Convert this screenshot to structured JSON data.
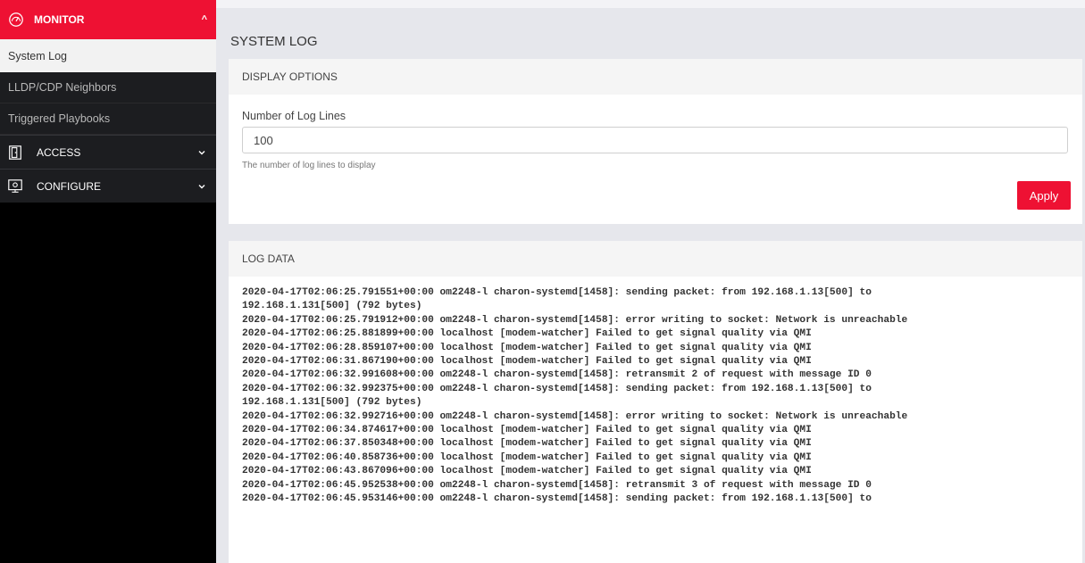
{
  "sidebar": {
    "monitor": {
      "label": "MONITOR",
      "icon": "speedometer-icon"
    },
    "monitor_items": [
      {
        "label": "System Log",
        "active": true
      },
      {
        "label": "LLDP/CDP Neighbors",
        "active": false
      },
      {
        "label": "Triggered Playbooks",
        "active": false
      }
    ],
    "access": {
      "label": "ACCESS",
      "icon": "door-icon"
    },
    "configure": {
      "label": "CONFIGURE",
      "icon": "monitor-gear-icon"
    }
  },
  "page": {
    "title": "SYSTEM LOG"
  },
  "display_options": {
    "header": "DISPLAY OPTIONS",
    "field_label": "Number of Log Lines",
    "field_value": "100",
    "help_text": "The number of log lines to display",
    "apply_label": "Apply"
  },
  "log": {
    "header": "LOG DATA",
    "lines": [
      "2020-04-17T02:06:25.791551+00:00 om2248-l charon-systemd[1458]: sending packet: from 192.168.1.13[500] to",
      "192.168.1.131[500] (792 bytes)",
      "2020-04-17T02:06:25.791912+00:00 om2248-l charon-systemd[1458]: error writing to socket: Network is unreachable",
      "2020-04-17T02:06:25.881899+00:00 localhost [modem-watcher] Failed to get signal quality via QMI",
      "2020-04-17T02:06:28.859107+00:00 localhost [modem-watcher] Failed to get signal quality via QMI",
      "2020-04-17T02:06:31.867190+00:00 localhost [modem-watcher] Failed to get signal quality via QMI",
      "2020-04-17T02:06:32.991608+00:00 om2248-l charon-systemd[1458]: retransmit 2 of request with message ID 0",
      "2020-04-17T02:06:32.992375+00:00 om2248-l charon-systemd[1458]: sending packet: from 192.168.1.13[500] to",
      "192.168.1.131[500] (792 bytes)",
      "2020-04-17T02:06:32.992716+00:00 om2248-l charon-systemd[1458]: error writing to socket: Network is unreachable",
      "2020-04-17T02:06:34.874617+00:00 localhost [modem-watcher] Failed to get signal quality via QMI",
      "2020-04-17T02:06:37.850348+00:00 localhost [modem-watcher] Failed to get signal quality via QMI",
      "2020-04-17T02:06:40.858736+00:00 localhost [modem-watcher] Failed to get signal quality via QMI",
      "2020-04-17T02:06:43.867096+00:00 localhost [modem-watcher] Failed to get signal quality via QMI",
      "2020-04-17T02:06:45.952538+00:00 om2248-l charon-systemd[1458]: retransmit 3 of request with message ID 0",
      "2020-04-17T02:06:45.953146+00:00 om2248-l charon-systemd[1458]: sending packet: from 192.168.1.13[500] to"
    ]
  },
  "colors": {
    "accent": "#ee1133",
    "sidebar_bg": "#000000",
    "sidebar_section": "#1c1d20",
    "page_bg": "#e6e7ec"
  }
}
